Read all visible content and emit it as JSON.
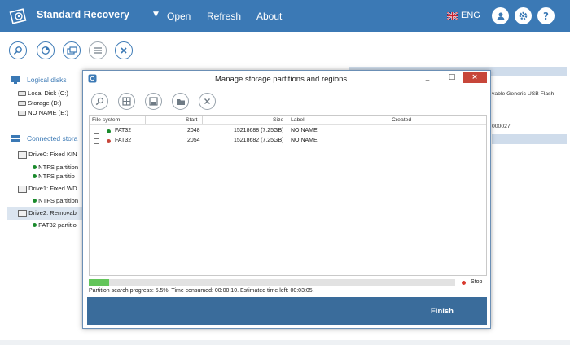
{
  "app": {
    "title": "Standard Recovery",
    "menu": [
      "Open",
      "Refresh",
      "About"
    ],
    "language": "ENG",
    "header_icons": [
      "user-icon",
      "gear-icon",
      "help-icon"
    ]
  },
  "toolbar": {
    "icons": [
      "search-icon",
      "scan-icon",
      "partition-icon",
      "list-icon",
      "close-icon"
    ]
  },
  "sidebar": {
    "logical_heading": "Logical disks",
    "logical_disks": [
      "Local Disk (C:)",
      "Storage (D:)",
      "NO NAME (E:)"
    ],
    "connected_heading": "Connected stora",
    "drives": [
      {
        "label": "Drive0: Fixed KIN",
        "partitions": [
          "NTFS partition",
          "NTFS partitio"
        ]
      },
      {
        "label": "Drive1: Fixed WD",
        "partitions": [
          "NTFS partition"
        ]
      },
      {
        "label": "Drive2: Removab",
        "partitions": [
          "FAT32 partitio"
        ]
      }
    ]
  },
  "right_panel": {
    "line1": "vable Generic USB Flash",
    "line2": "000027"
  },
  "dialog": {
    "title": "Manage storage partitions and regions",
    "title_controls": [
      "_",
      "□",
      "×"
    ],
    "tool_icons": [
      "search-icon",
      "table-icon",
      "save-icon",
      "folder-icon",
      "close-icon"
    ],
    "columns": [
      "File system",
      "Start",
      "Size",
      "Label",
      "Created"
    ],
    "rows": [
      {
        "fs": "FAT32",
        "start": "2048",
        "size": "15218688 (7.25GB)",
        "label": "NO NAME",
        "created": "",
        "dot_color": "#1a8a2c"
      },
      {
        "fs": "FAT32",
        "start": "2054",
        "size": "15218682 (7.25GB)",
        "label": "NO NAME",
        "created": "",
        "dot_color": "#c7463a"
      }
    ],
    "progress_percent": 5.5,
    "stop_label": "Stop",
    "status": "Partition search progress: 5.5%. Time consumed: 00:00:10. Estimated time left: 00:03:05.",
    "finish_label": "Finish"
  },
  "colors": {
    "accent": "#3b79b5",
    "footer": "#3a6c9b",
    "progress": "#63c55a",
    "stop": "#d83a2e"
  }
}
